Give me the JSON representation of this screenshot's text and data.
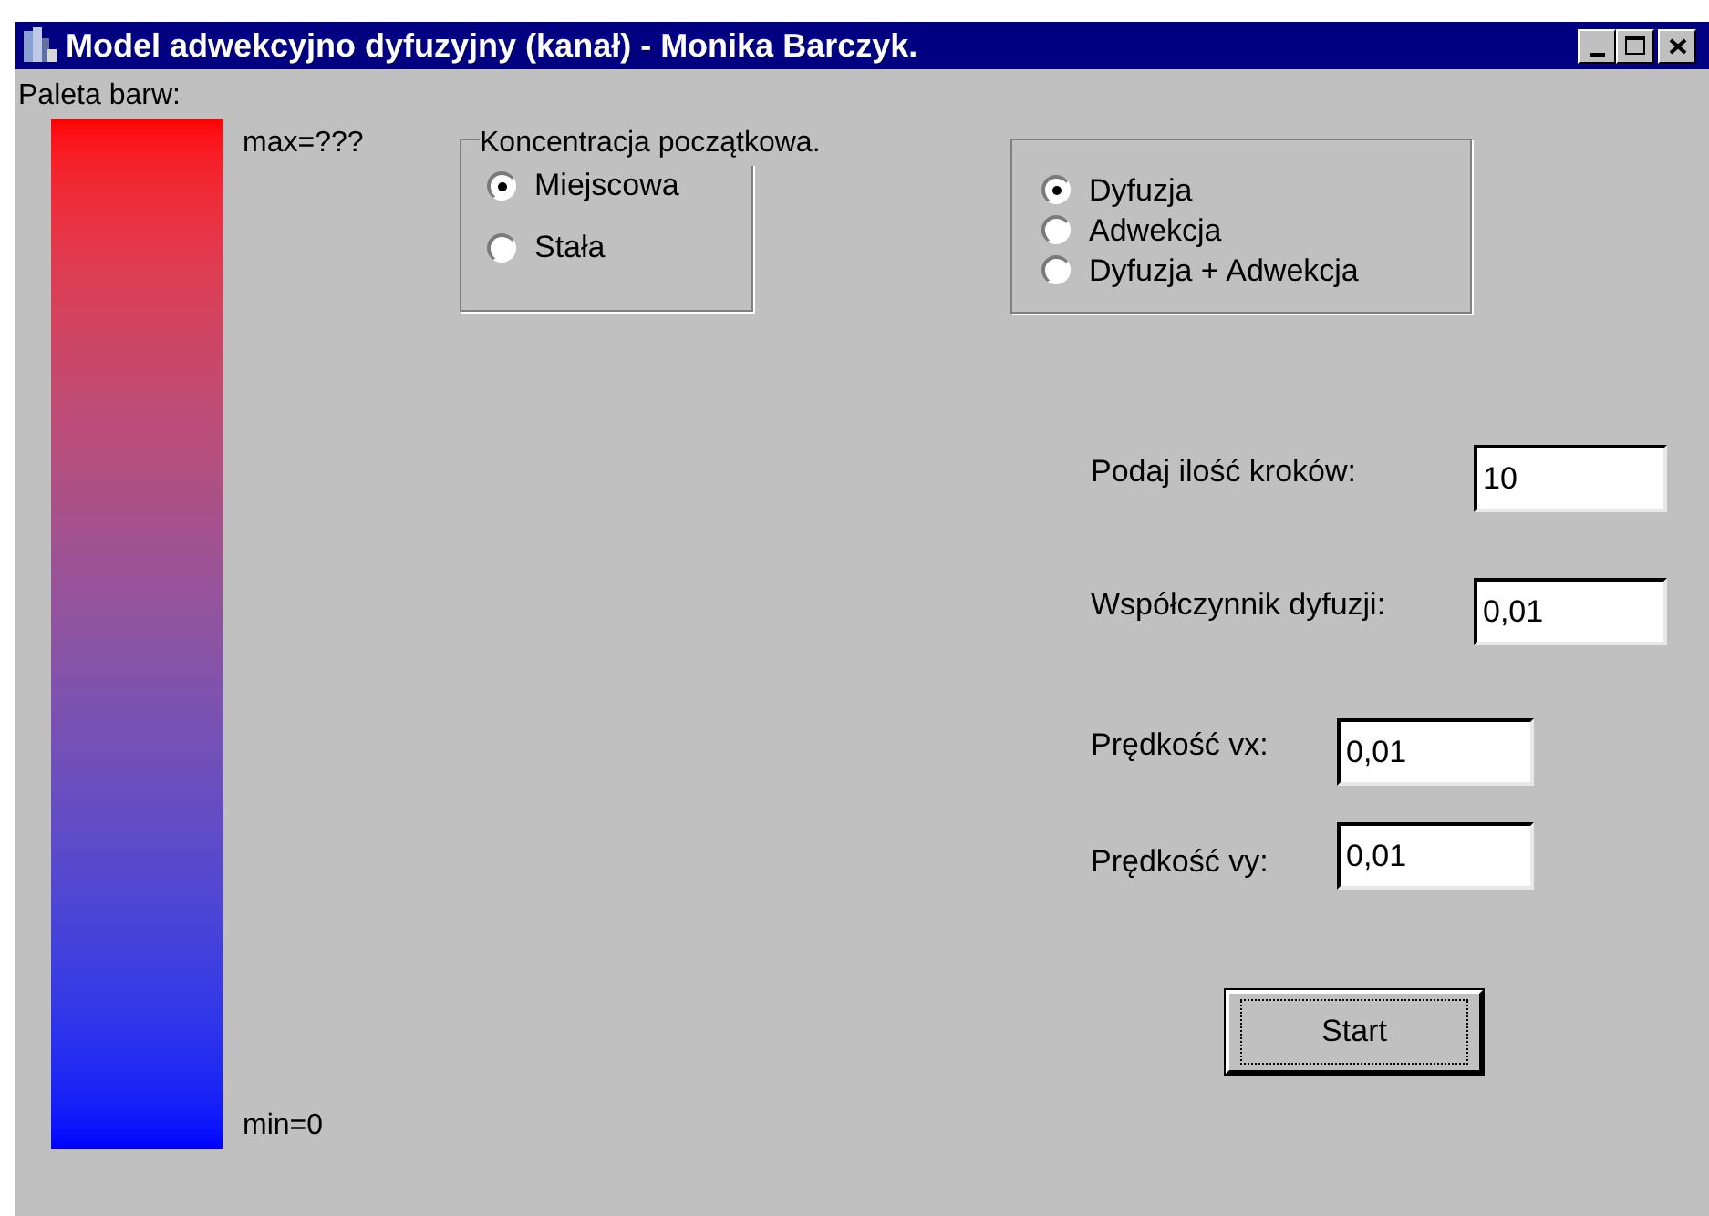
{
  "window": {
    "title": "Model adwekcyjno dyfuzyjny (kanał) - Monika Barczyk."
  },
  "palette": {
    "label": "Paleta barw:",
    "max_label": "max=???",
    "min_label": "min=0"
  },
  "initial_concentration": {
    "title": "Koncentracja początkowa.",
    "options": [
      {
        "label": "Miejscowa",
        "selected": true
      },
      {
        "label": "Stała",
        "selected": false
      }
    ]
  },
  "mode": {
    "options": [
      {
        "label": "Dyfuzja",
        "selected": true
      },
      {
        "label": "Adwekcja",
        "selected": false
      },
      {
        "label": "Dyfuzja + Adwekcja",
        "selected": false
      }
    ]
  },
  "fields": [
    {
      "label": "Podaj ilość kroków:",
      "value": "10"
    },
    {
      "label": "Współczynnik dyfuzji:",
      "value": "0,01"
    },
    {
      "label": "Prędkość vx:",
      "value": "0,01"
    },
    {
      "label": "Prędkość vy:",
      "value": "0,01"
    }
  ],
  "start_button": "Start"
}
